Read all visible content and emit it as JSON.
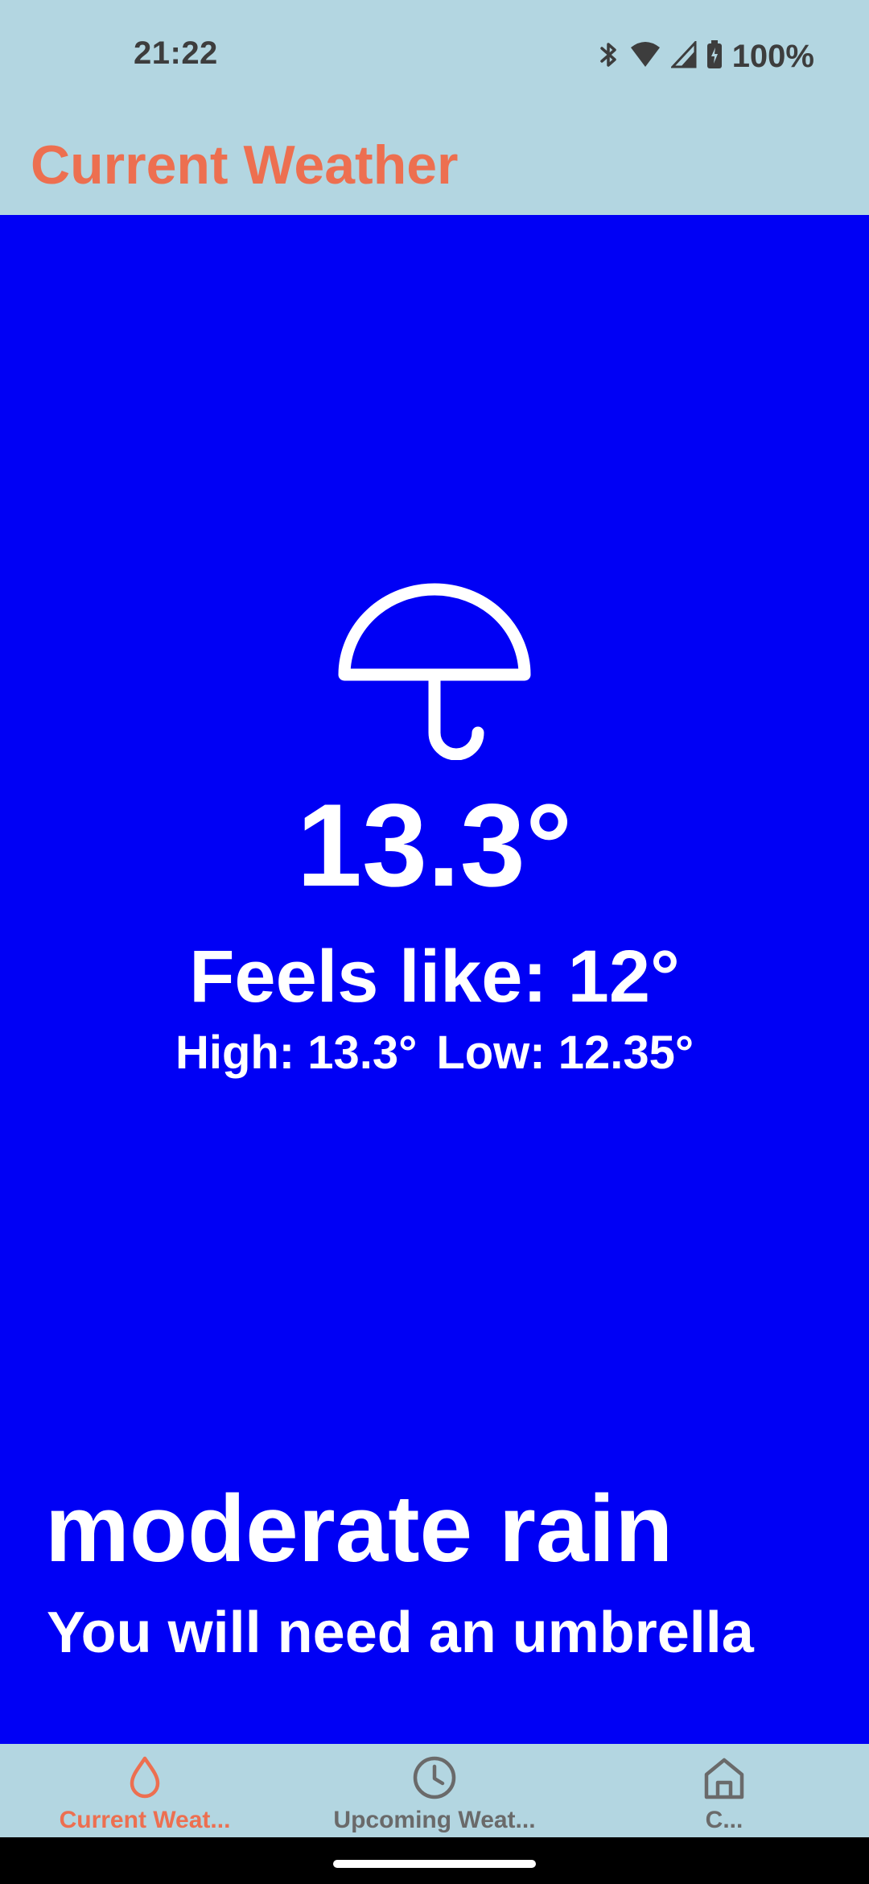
{
  "status_bar": {
    "time": "21:22",
    "battery_percent": "100%",
    "icons": [
      "bluetooth-icon",
      "wifi-icon",
      "cellular-signal-icon",
      "battery-icon"
    ]
  },
  "app_bar": {
    "title": "Current Weather"
  },
  "weather": {
    "icon": "umbrella-icon",
    "temperature": "13.3°",
    "feels_like": "Feels like: 12°",
    "high": "High: 13.3°",
    "low": "Low: 12.35°",
    "condition": "moderate rain",
    "advice": "You will need an umbrella"
  },
  "bottom_nav": {
    "items": [
      {
        "label": "Current Weat...",
        "icon": "raindrop-icon",
        "active": true
      },
      {
        "label": "Upcoming Weat...",
        "icon": "clock-icon",
        "active": false
      },
      {
        "label": "C...",
        "icon": "home-icon",
        "active": false
      }
    ]
  },
  "colors": {
    "background": "#b3d6e1",
    "content_blue": "#0000f5",
    "accent": "#ed6f50",
    "text_on_blue": "#ffffff",
    "inactive": "#6a6a6a"
  }
}
